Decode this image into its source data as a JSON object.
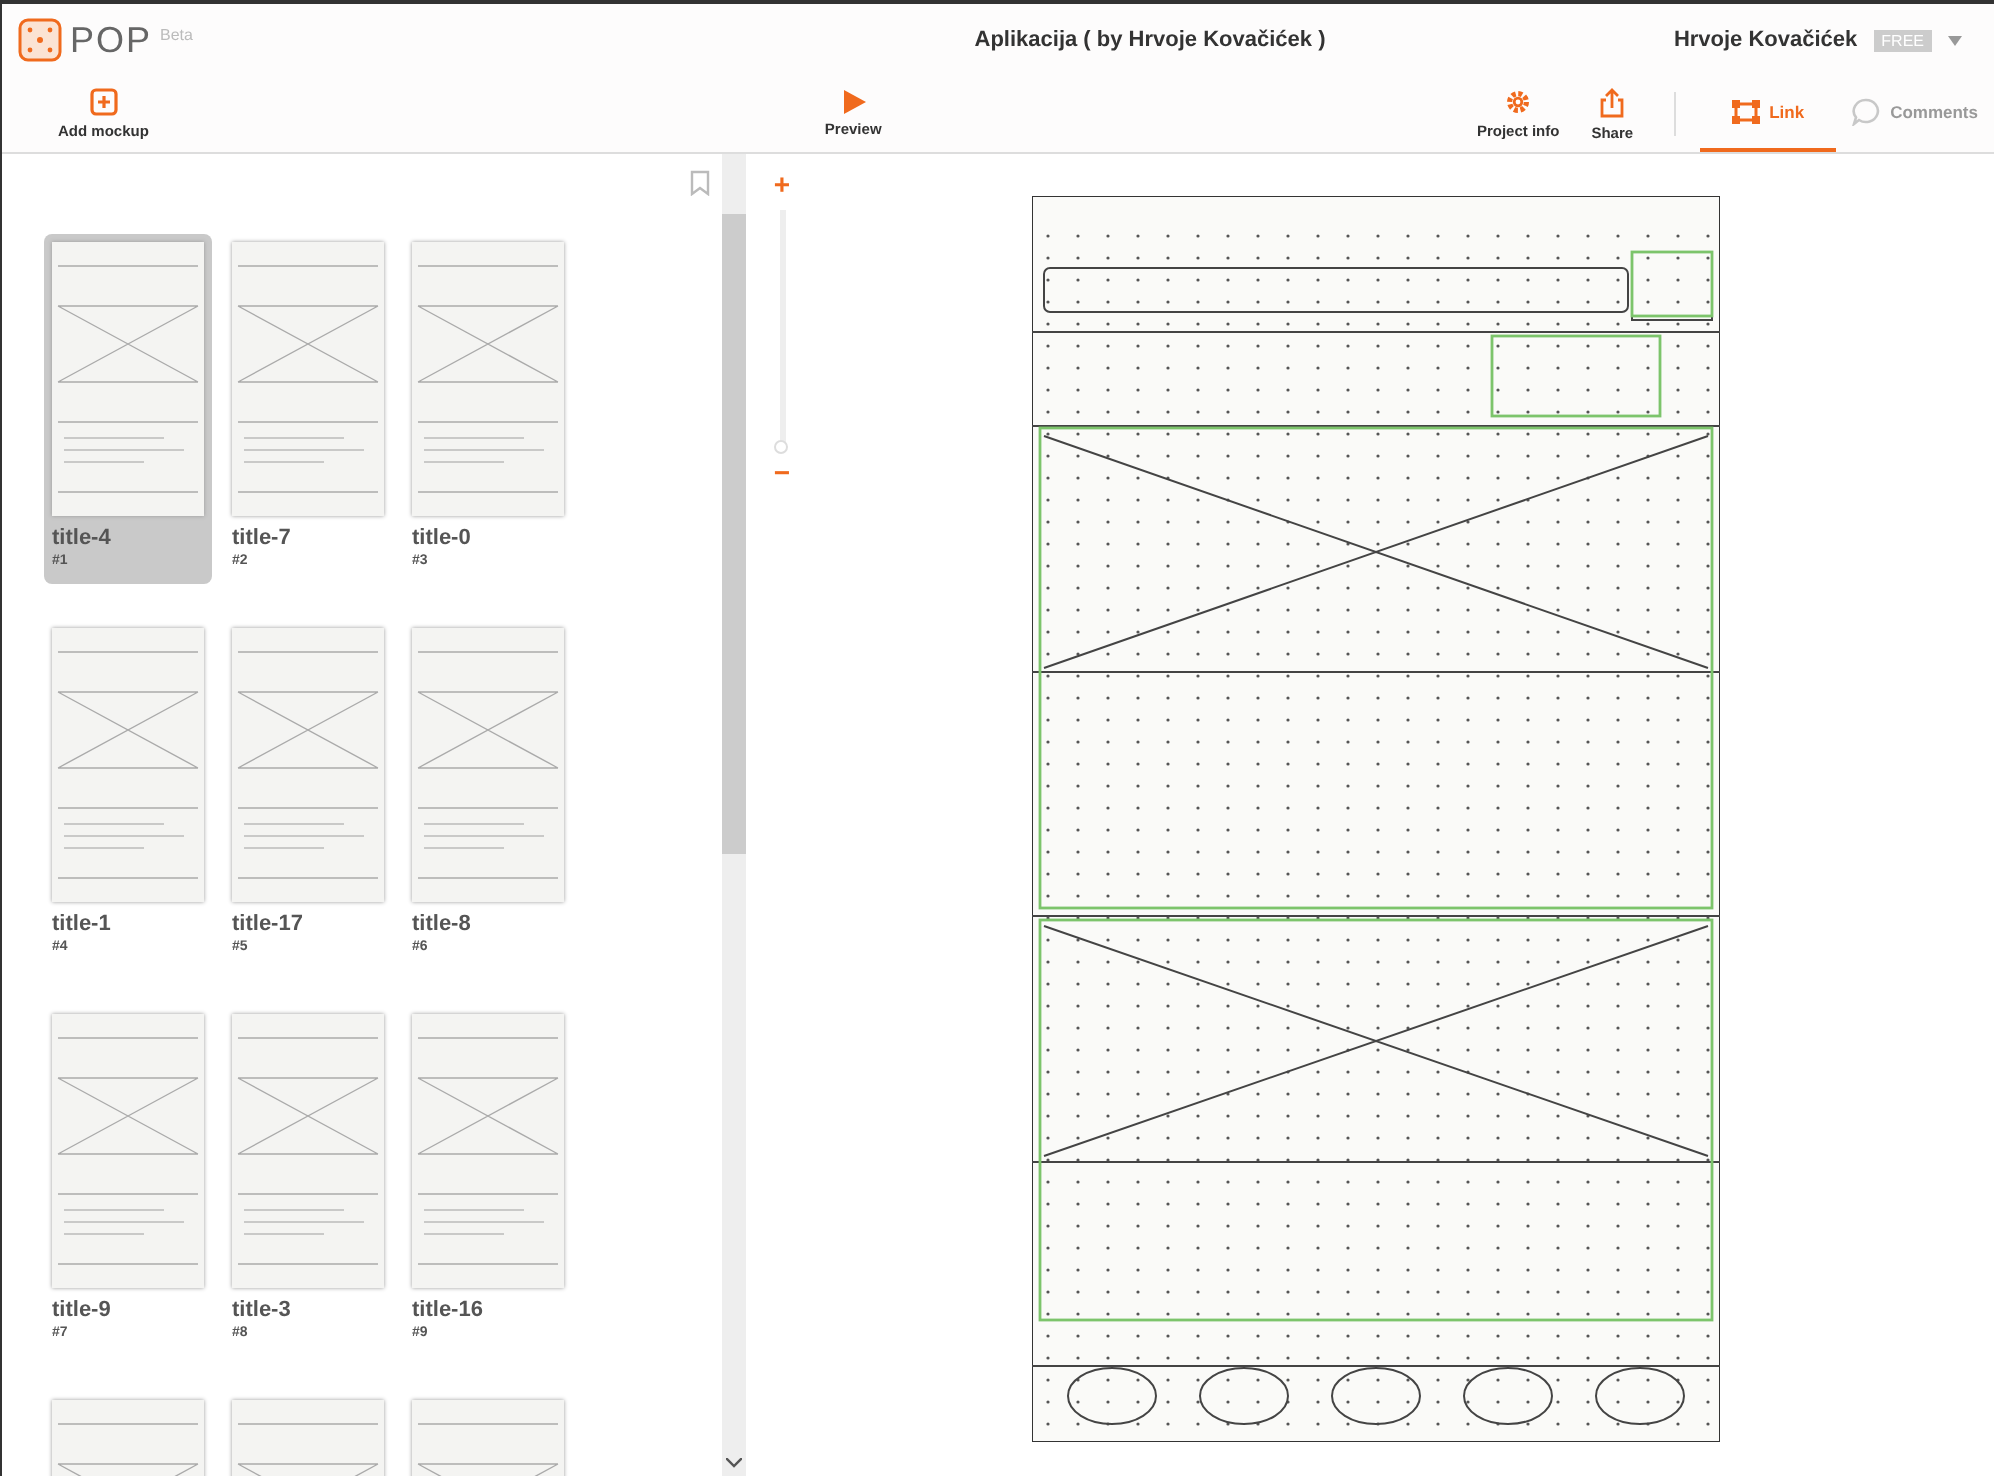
{
  "header": {
    "logo": "POP",
    "badge": "Beta",
    "title": "Aplikacija ( by Hrvoje Kovačićek )",
    "user": "Hrvoje Kovačićek",
    "plan": "FREE"
  },
  "toolbar": {
    "add": "Add mockup",
    "preview": "Preview",
    "actions": [
      {
        "kind": "gear",
        "label": "Project info"
      },
      {
        "kind": "share",
        "label": "Share"
      }
    ],
    "tabs": [
      {
        "kind": "link",
        "label": "Link",
        "selected": true
      },
      {
        "kind": "comment",
        "label": "Comments",
        "selected": false
      }
    ]
  },
  "screens": [
    {
      "title": "title-4",
      "number": "#1",
      "selected": true
    },
    {
      "title": "title-7",
      "number": "#2",
      "selected": false
    },
    {
      "title": "title-0",
      "number": "#3",
      "selected": false
    },
    {
      "title": "title-1",
      "number": "#4",
      "selected": false
    },
    {
      "title": "title-17",
      "number": "#5",
      "selected": false
    },
    {
      "title": "title-8",
      "number": "#6",
      "selected": false
    },
    {
      "title": "title-9",
      "number": "#7",
      "selected": false
    },
    {
      "title": "title-3",
      "number": "#8",
      "selected": false
    },
    {
      "title": "title-16",
      "number": "#9",
      "selected": false
    },
    {
      "selected": false
    },
    {
      "selected": false
    },
    {
      "selected": false
    }
  ],
  "zoom": {
    "in": "+",
    "out": "−",
    "level": 0.0
  }
}
